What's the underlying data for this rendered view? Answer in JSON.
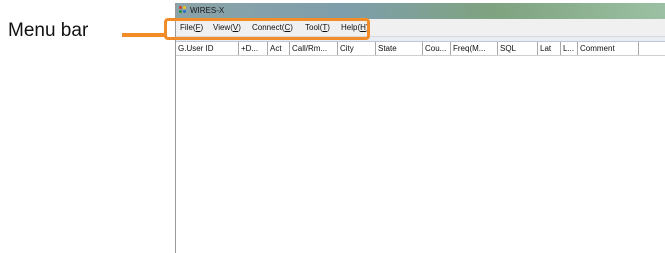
{
  "annotation": {
    "label": "Menu bar",
    "color": "#f28c28"
  },
  "window": {
    "title": "WIRES-X"
  },
  "menu": [
    {
      "name": "File",
      "key": "F"
    },
    {
      "name": "View",
      "key": "V"
    },
    {
      "name": "Connect",
      "key": "C"
    },
    {
      "name": "Tool",
      "key": "T"
    },
    {
      "name": "Help",
      "key": "H"
    }
  ],
  "columns": [
    "G.User ID",
    "+D...",
    "Act",
    "Call/Rm...",
    "City",
    "State",
    "Cou...",
    "Freq(M...",
    "SQL",
    "Lat",
    "L...",
    "Comment"
  ]
}
